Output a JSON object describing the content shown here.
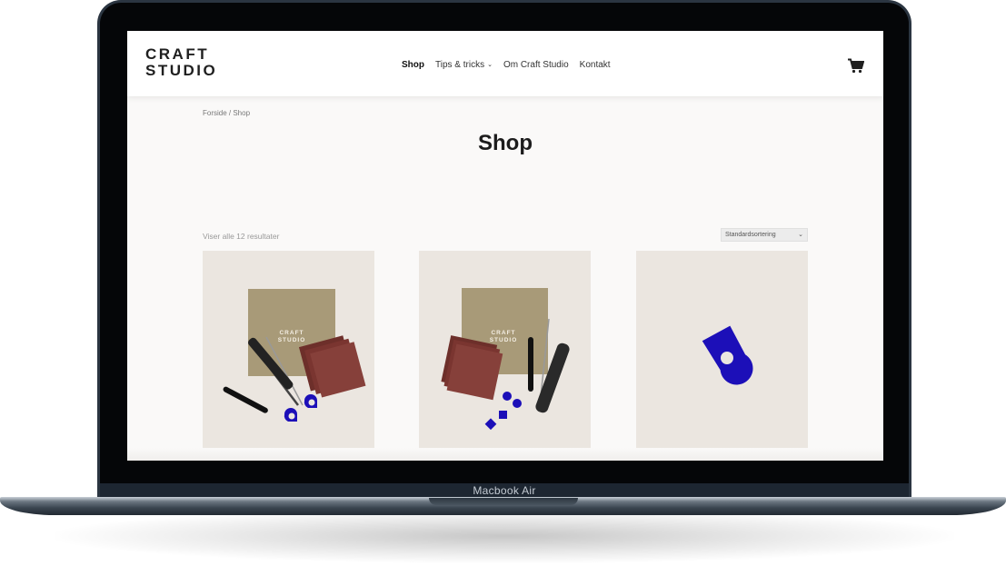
{
  "device": {
    "label": "Macbook Air"
  },
  "header": {
    "logo_line1": "CRAFT",
    "logo_line2": "STUDIO",
    "nav": [
      {
        "label": "Shop",
        "active": true
      },
      {
        "label": "Tips & tricks",
        "dropdown": true
      },
      {
        "label": "Om Craft Studio"
      },
      {
        "label": "Kontakt"
      }
    ],
    "cart_icon": "shopping-cart-icon"
  },
  "breadcrumb": "Forside / Shop",
  "page_title": "Shop",
  "results_text": "Viser alle 12 resultater",
  "sort": {
    "selected": "Standardsortering"
  },
  "products": [
    {
      "image_label_line1": "CRAFT",
      "image_label_line2": "STUDIO"
    },
    {
      "image_label_line1": "CRAFT",
      "image_label_line2": "STUDIO"
    },
    {
      "image_label_line1": "",
      "image_label_line2": ""
    }
  ],
  "colors": {
    "accent_blue": "#1c0fb8",
    "card_bg": "#ebe6e0",
    "page_bg": "#faf9f8"
  }
}
